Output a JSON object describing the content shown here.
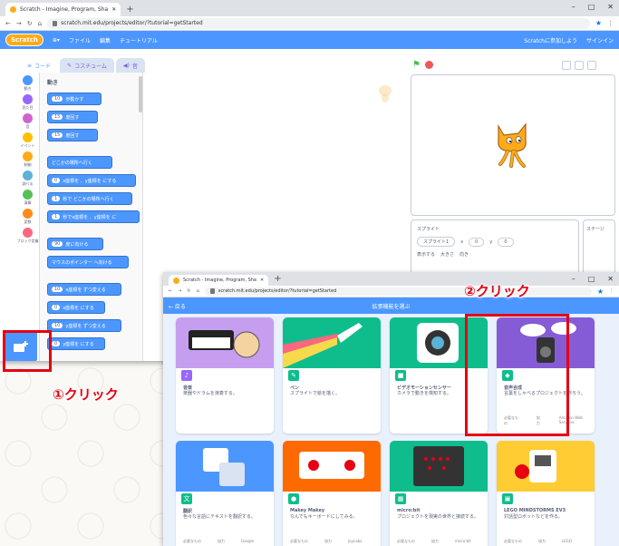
{
  "main_window": {
    "tab_title": "Scratch - Imagine, Program, Sha",
    "url": "scratch.mit.edu/projects/editor/?tutorial=getStarted",
    "menu": {
      "logo": "Scratch",
      "file": "ファイル",
      "edit": "編集",
      "tutorials": "チュートリアル",
      "join": "Scratchに参加しよう",
      "signin": "サインイン"
    },
    "editor_tabs": [
      "コード",
      "コスチューム",
      "音"
    ],
    "categories": [
      {
        "label": "動き",
        "color": "#4c97ff"
      },
      {
        "label": "見た目",
        "color": "#9966ff"
      },
      {
        "label": "音",
        "color": "#cf63cf"
      },
      {
        "label": "イベント",
        "color": "#ffbf00"
      },
      {
        "label": "制御",
        "color": "#ffab19"
      },
      {
        "label": "調べる",
        "color": "#5cb1d6"
      },
      {
        "label": "演算",
        "color": "#59c059"
      },
      {
        "label": "変数",
        "color": "#ff8c1a"
      },
      {
        "label": "ブロック定義",
        "color": "#ff6680"
      }
    ],
    "palette_title": "動き",
    "blocks": [
      {
        "text": "歩動かす",
        "pill": "10"
      },
      {
        "text": "度回す",
        "pill": "15"
      },
      {
        "text": "度回す",
        "pill": "15"
      },
      {
        "text": "どこかの場所へ行く",
        "pill": ""
      },
      {
        "text": "x座標を 、y座標を にする",
        "pill": "0"
      },
      {
        "text": "秒で どこかの場所へ行く",
        "pill": "1"
      },
      {
        "text": "秒でx座標を 、y座標を に",
        "pill": "1"
      },
      {
        "text": "度に向ける",
        "pill": "90"
      },
      {
        "text": "マウスのポインター へ向ける",
        "pill": ""
      },
      {
        "text": "x座標を ずつ変える",
        "pill": "10"
      },
      {
        "text": "x座標を にする",
        "pill": "0"
      },
      {
        "text": "y座標を ずつ変える",
        "pill": "10"
      },
      {
        "text": "y座標を にする",
        "pill": "0"
      }
    ],
    "sprite_pane": {
      "label": "スプライト",
      "name": "スプライト1",
      "x_label": "x",
      "x": "0",
      "y_label": "y",
      "y": "0",
      "show": "表示する",
      "size": "大きさ",
      "direction": "向き"
    },
    "stage_label": "ステージ"
  },
  "ext_window": {
    "tab_title": "Scratch - Imagine, Program, Sha",
    "url": "scratch.mit.edu/projects/editor/?tutorial=getStarted",
    "back": "← 戻る",
    "header": "拡張機能を選ぶ",
    "cards": [
      {
        "title": "音楽",
        "desc": "楽器やドラムを演奏する。",
        "color": "#9966ff",
        "icon": "♪"
      },
      {
        "title": "ペン",
        "desc": "スプライトで絵を描く。",
        "color": "#0fbd8c",
        "icon": "✎"
      },
      {
        "title": "ビデオモーションセンサー",
        "desc": "カメラで動きを検知する。",
        "color": "#0fbd8c",
        "icon": "■"
      },
      {
        "title": "音声合成",
        "desc": "言葉をしゃべるプロジェクトを作ろう。",
        "color": "#0fbd8c",
        "icon": "◆",
        "meta1": "必要なもの",
        "meta2": "協力",
        "meta3": "Amazon Web Services"
      },
      {
        "title": "翻訳",
        "desc": "色々な言語にテキストを翻訳する。",
        "color": "#0fbd8c",
        "icon": "文",
        "meta1": "必要なもの",
        "meta2": "協力",
        "meta3": "Google"
      },
      {
        "title": "Makey Makey",
        "desc": "なんでもキーボードにしてみる。",
        "color": "#0fbd8c",
        "icon": "●",
        "meta1": "必要なもの",
        "meta2": "協力",
        "meta3": "JoyLabz"
      },
      {
        "title": "micro:bit",
        "desc": "プロジェクトを現実の世界と接続する。",
        "color": "#0fbd8c",
        "icon": "▦",
        "meta1": "必要なもの",
        "meta2": "協力",
        "meta3": "micro:bit"
      },
      {
        "title": "LEGO MINDSTORMS EV3",
        "desc": "対話型ロボットなどを作る。",
        "color": "#0fbd8c",
        "icon": "▣",
        "meta1": "必要なもの",
        "meta2": "協力",
        "meta3": "LEGO"
      }
    ]
  },
  "annotations": {
    "step1": "①クリック",
    "step2": "②クリック"
  }
}
